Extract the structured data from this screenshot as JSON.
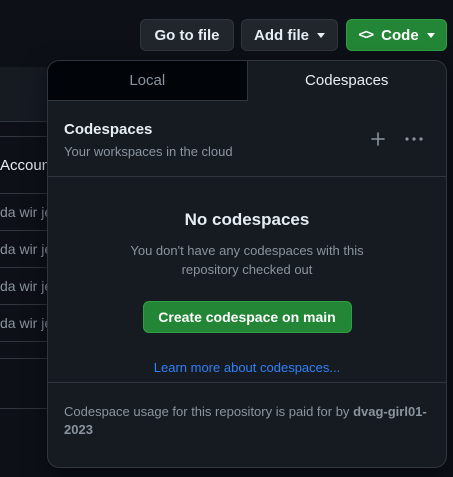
{
  "toolbar": {
    "goto_label": "Go to file",
    "add_file_label": "Add file",
    "code_label": "Code",
    "code_icon": "code-brackets-icon"
  },
  "background": {
    "account_header": "Accoun",
    "rows": [
      "da wir je",
      "da wir je",
      "da wir je",
      "da wir je"
    ]
  },
  "dropdown": {
    "tabs": [
      {
        "label": "Local",
        "selected": false
      },
      {
        "label": "Codespaces",
        "selected": true
      }
    ],
    "section": {
      "title": "Codespaces",
      "subtitle": "Your workspaces in the cloud",
      "add_icon": "plus-icon",
      "more_icon": "kebab-horizontal-icon"
    },
    "empty": {
      "title": "No codespaces",
      "description": "You don't have any codespaces with this repository checked out",
      "create_label": "Create codespace on main",
      "learn_label": "Learn more about codespaces..."
    },
    "footer": {
      "text": "Codespace usage for this repository is paid for by",
      "owner": "dvag-girl01-2023"
    }
  },
  "colors": {
    "background": "#0d1117",
    "panel": "#161b22",
    "border": "#30363d",
    "primary_green": "#238636",
    "link_blue": "#2f81f7",
    "muted_text": "#8b949e"
  }
}
